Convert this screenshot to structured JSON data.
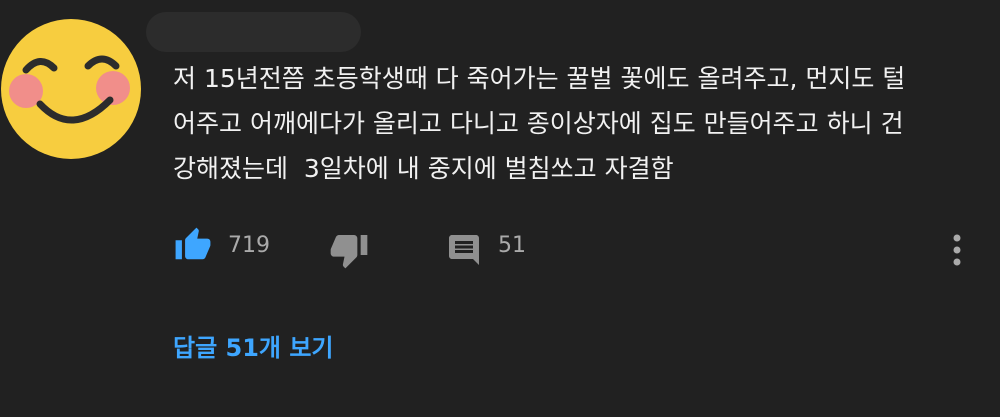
{
  "comment": {
    "avatar_icon": "smiling-face-emoji-icon",
    "text_lines": [
      "저 15년전쯤 초등학생때 다 죽어가는 꿀벌 꽃에도 올려주고, 먼지도 털",
      "어주고 어깨에다가 올리고 다니고 종이상자에 집도 만들어주고 하니 건",
      "강해졌는데  3일차에 내 중지에 벌침쏘고 자결함"
    ],
    "like_icon": "thumbs-up-icon",
    "like_count": "719",
    "dislike_icon": "thumbs-down-icon",
    "reply_icon": "comment-icon",
    "reply_count": "51",
    "more_icon": "more-vertical-icon",
    "view_replies_label": "답글 51개 보기"
  },
  "colors": {
    "background": "#212121",
    "text": "#f1f1f1",
    "muted": "#aaaaaa",
    "like_active": "#3ea6ff",
    "link": "#3ea6ff"
  }
}
